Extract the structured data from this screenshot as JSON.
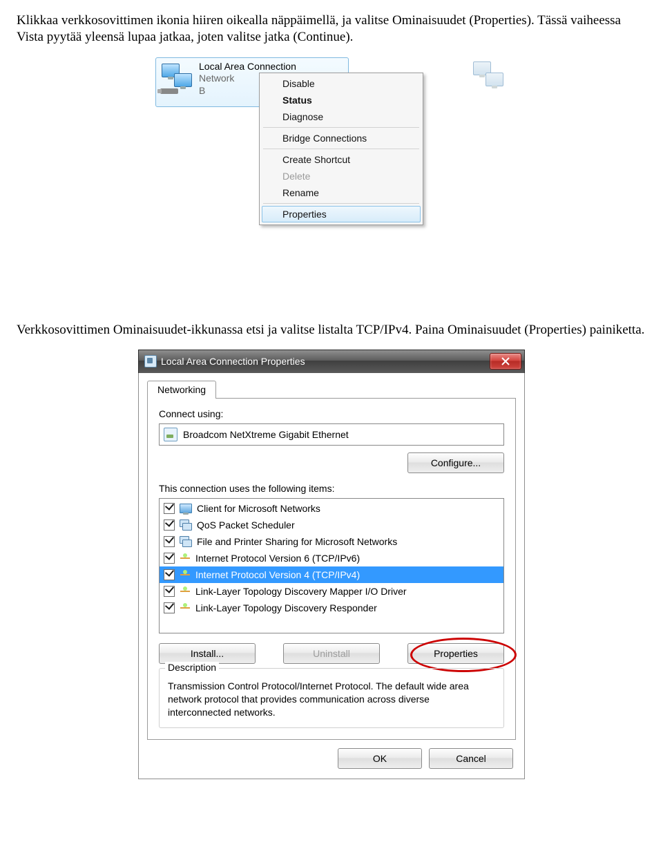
{
  "para1": "Klikkaa verkkosovittimen ikonia hiiren oikealla näppäimellä, ja valitse Ominaisuudet (Properties). Tässä vaiheessa Vista pyytää yleensä lupaa jatkaa, joten valitse jatka (Continue).",
  "para2_a": "Verkkosovittimen Ominaisuudet-ikkunassa etsi ja valitse listalta TCP/IPv4. Paina Ominaisuudet (Properties) painiketta.",
  "conn": {
    "title": "Local Area Connection",
    "line2": "Network",
    "line3": "B"
  },
  "menu": {
    "disable": "Disable",
    "status": "Status",
    "diagnose": "Diagnose",
    "bridge": "Bridge Connections",
    "shortcut": "Create Shortcut",
    "delete": "Delete",
    "rename": "Rename",
    "properties": "Properties"
  },
  "dlg": {
    "title": "Local Area Connection  Properties",
    "tab": "Networking",
    "connect_using": "Connect using:",
    "adapter": "Broadcom NetXtreme Gigabit Ethernet",
    "configure": "Configure...",
    "uses_label": "This connection uses the following items:",
    "items": [
      "Client for Microsoft Networks",
      "QoS Packet Scheduler",
      "File and Printer Sharing for Microsoft Networks",
      "Internet Protocol Version 6 (TCP/IPv6)",
      "Internet Protocol Version 4 (TCP/IPv4)",
      "Link-Layer Topology Discovery Mapper I/O Driver",
      "Link-Layer Topology Discovery Responder"
    ],
    "install": "Install...",
    "uninstall": "Uninstall",
    "properties": "Properties",
    "desc_label": "Description",
    "desc_text": "Transmission Control Protocol/Internet Protocol. The default wide area network protocol that provides communication across diverse interconnected networks.",
    "ok": "OK",
    "cancel": "Cancel"
  }
}
